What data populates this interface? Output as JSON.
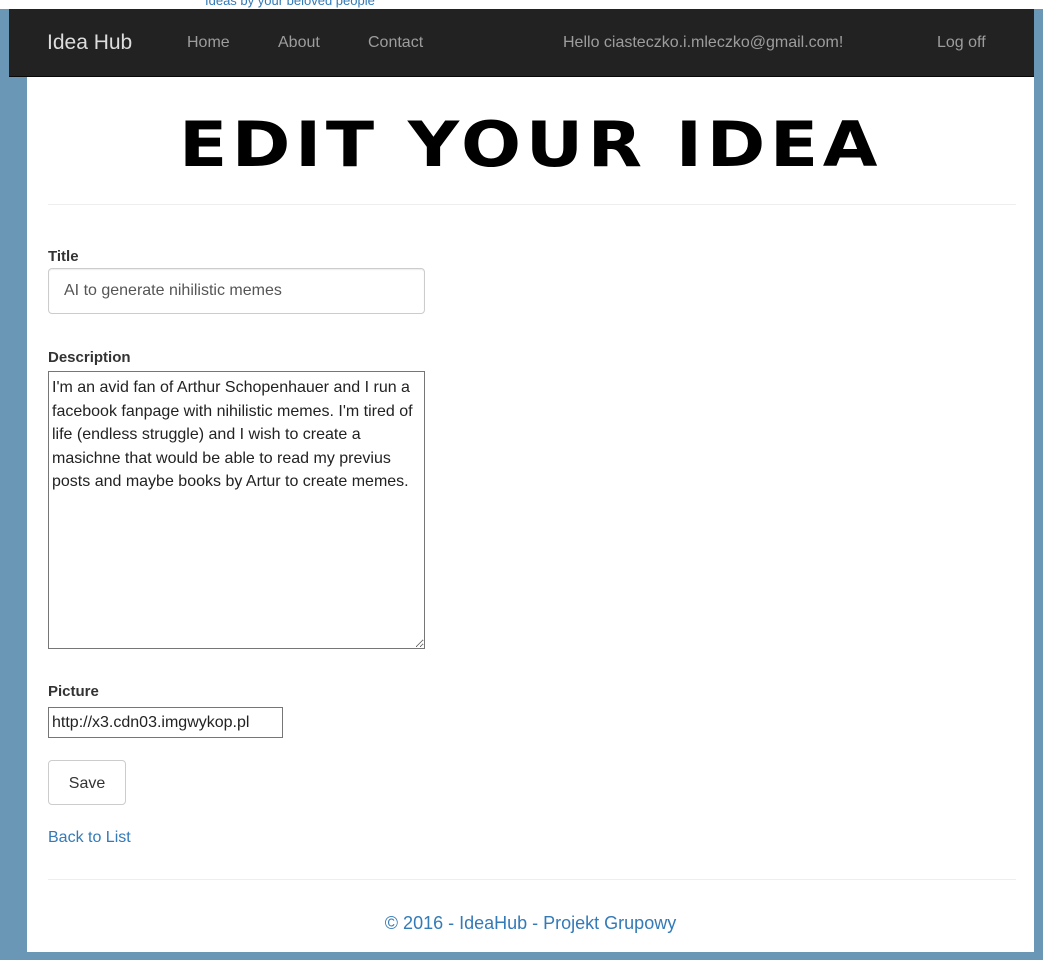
{
  "top_strip": {
    "text": "Ideas by your beloved people"
  },
  "navbar": {
    "brand": "Idea Hub",
    "links": [
      "Home",
      "About",
      "Contact"
    ],
    "greeting": "Hello ciasteczko.i.mleczko@gmail.com!",
    "logoff": "Log off"
  },
  "page": {
    "heading": "EDIT YOUR IDEA"
  },
  "form": {
    "title_label": "Title",
    "title_value": "AI to generate nihilistic memes",
    "description_label": "Description",
    "description_value": "I'm an avid fan of Arthur Schopenhauer and I run a facebook fanpage with nihilistic memes. I'm tired of life (endless struggle) and I wish to create a masichne that would be able to read my previus posts and maybe books by Artur to create memes.",
    "picture_label": "Picture",
    "picture_value": "http://x3.cdn03.imgwykop.pl",
    "save_label": "Save",
    "back_label": "Back to List"
  },
  "footer": {
    "text": "© 2016 - IdeaHub - Projekt Grupowy"
  },
  "colors": {
    "navbar_bg": "#222222",
    "page_bg": "#6b97b7",
    "link": "#337ab7"
  }
}
